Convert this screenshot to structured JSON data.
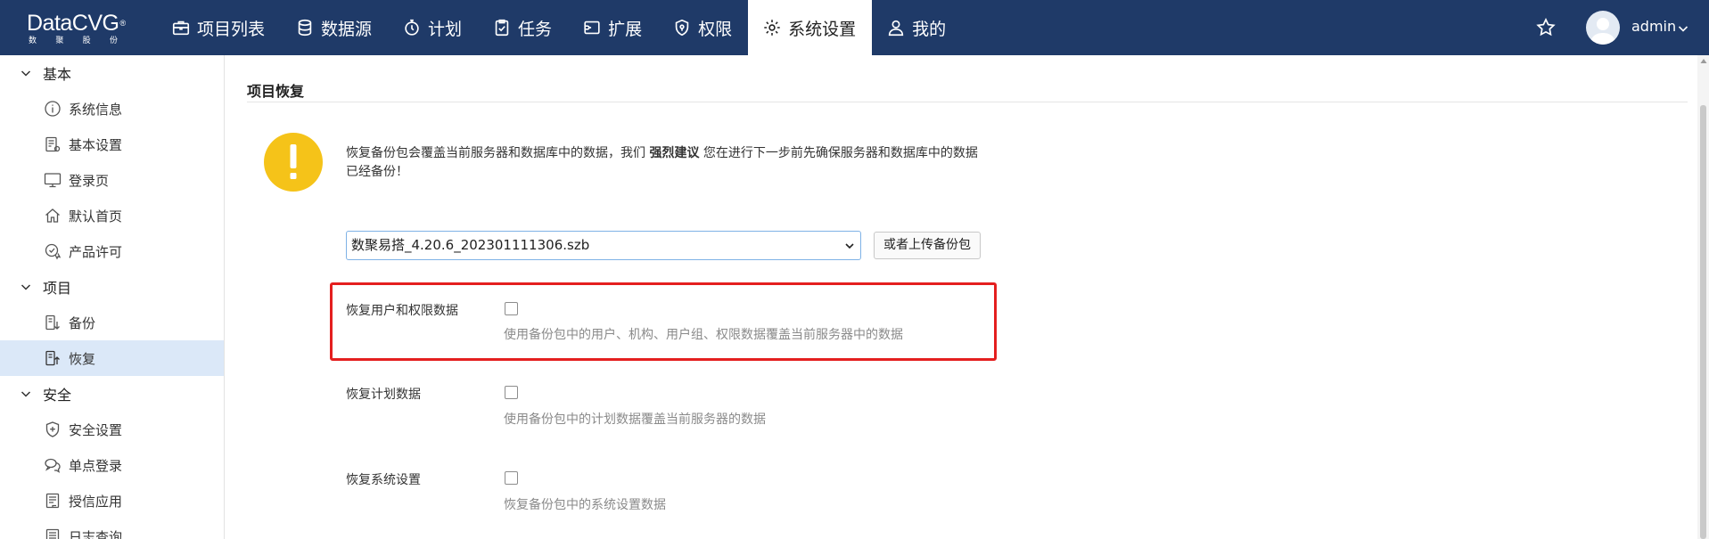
{
  "brand": {
    "logo_text": "DataCVG",
    "logo_reg": "®",
    "logo_sub": [
      "数",
      "聚",
      "股",
      "份"
    ]
  },
  "nav": {
    "items": [
      {
        "label": "项目列表",
        "icon": "briefcase-icon"
      },
      {
        "label": "数据源",
        "icon": "database-icon"
      },
      {
        "label": "计划",
        "icon": "stopwatch-icon"
      },
      {
        "label": "任务",
        "icon": "clipboard-check-icon"
      },
      {
        "label": "扩展",
        "icon": "extension-icon"
      },
      {
        "label": "权限",
        "icon": "shield-icon"
      },
      {
        "label": "系统设置",
        "icon": "gear-icon",
        "active": true
      },
      {
        "label": "我的",
        "icon": "user-icon"
      }
    ],
    "username": "admin"
  },
  "sidebar": {
    "sections": [
      {
        "label": "基本",
        "items": [
          {
            "label": "系统信息",
            "icon": "info-circle-icon"
          },
          {
            "label": "基本设置",
            "icon": "settings-sheet-icon"
          },
          {
            "label": "登录页",
            "icon": "monitor-icon"
          },
          {
            "label": "默认首页",
            "icon": "home-icon"
          },
          {
            "label": "产品许可",
            "icon": "license-icon"
          }
        ]
      },
      {
        "label": "项目",
        "items": [
          {
            "label": "备份",
            "icon": "backup-icon"
          },
          {
            "label": "恢复",
            "icon": "restore-icon",
            "active": true
          }
        ]
      },
      {
        "label": "安全",
        "items": [
          {
            "label": "安全设置",
            "icon": "shield-plus-icon"
          },
          {
            "label": "单点登录",
            "icon": "chat-bubbles-icon"
          },
          {
            "label": "授信应用",
            "icon": "document-list-icon"
          },
          {
            "label": "日志查询",
            "icon": "log-icon"
          }
        ]
      }
    ]
  },
  "main": {
    "title": "项目恢复",
    "warning": {
      "text_before": "恢复备份包会覆盖当前服务器和数据库中的数据，我们 ",
      "text_bold": "强烈建议",
      "text_after": " 您在进行下一步前先确保服务器和数据库中的数据已经备份！"
    },
    "backup_select_value": "数聚易搭_4.20.6_202301111306.szb",
    "upload_button": "或者上传备份包",
    "options": [
      {
        "label": "恢复用户和权限数据",
        "checked": false,
        "desc": "使用备份包中的用户、机构、用户组、权限数据覆盖当前服务器中的数据"
      },
      {
        "label": "恢复计划数据",
        "checked": false,
        "desc": "使用备份包中的计划数据覆盖当前服务器的数据"
      },
      {
        "label": "恢复系统设置",
        "checked": false,
        "desc": "恢复备份包中的系统设置数据"
      }
    ]
  },
  "colors": {
    "topbar": "#1f3a68",
    "sidebar_active": "#dbe8f8",
    "warning_yellow": "#f5c319",
    "highlight_red": "#e41f1f",
    "select_border": "#7fb2e6"
  }
}
